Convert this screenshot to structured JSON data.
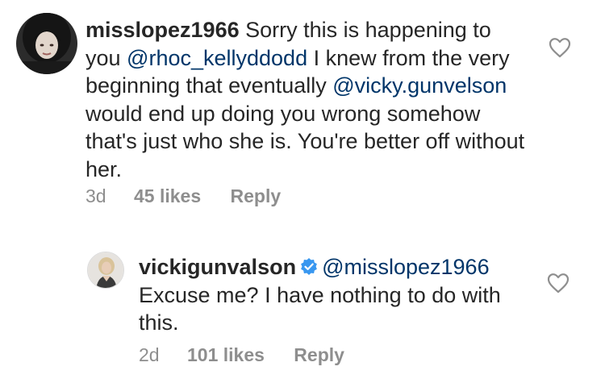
{
  "comments": [
    {
      "username": "misslopez1966",
      "segments": [
        {
          "type": "text",
          "text": "Sorry this is happening to you "
        },
        {
          "type": "mention",
          "text": "@rhoc_kellyddodd"
        },
        {
          "type": "text",
          "text": " I knew from the very beginning that eventually "
        },
        {
          "type": "mention",
          "text": "@vicky.gunvelson"
        },
        {
          "type": "text",
          "text": " would end up doing you wrong somehow that's just who she is. You're better off without her."
        }
      ],
      "time": "3d",
      "likes": "45 likes",
      "reply_label": "Reply"
    },
    {
      "username": "vickigunvalson",
      "verified": true,
      "segments": [
        {
          "type": "mention",
          "text": "@misslopez1966"
        },
        {
          "type": "text",
          "text": " Excuse me?  I have nothing to do with this."
        }
      ],
      "time": "2d",
      "likes": "101 likes",
      "reply_label": "Reply"
    }
  ],
  "icons": {
    "like": "heart-outline-icon",
    "verified": "verified-badge-icon"
  },
  "colors": {
    "text": "#262626",
    "mention": "#003569",
    "muted": "#8e8e8e",
    "verified": "#3897f0"
  }
}
